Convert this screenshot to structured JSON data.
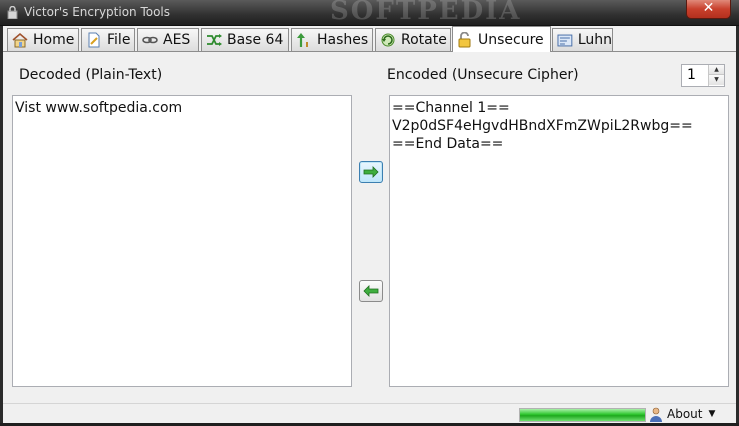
{
  "window": {
    "title": "Victor's Encryption Tools",
    "close_glyph": "✕",
    "watermark": "SOFTPEDIA"
  },
  "tabs": [
    {
      "label": "Home",
      "icon": "home-icon",
      "active": false
    },
    {
      "label": "File",
      "icon": "file-icon",
      "active": false
    },
    {
      "label": "AES",
      "icon": "chain-icon",
      "active": false
    },
    {
      "label": "Base 64",
      "icon": "shuffle-icon",
      "active": false
    },
    {
      "label": "Hashes",
      "icon": "hash-arrow-icon",
      "active": false
    },
    {
      "label": "Rotate",
      "icon": "rotate-icon",
      "active": false
    },
    {
      "label": "Unsecure",
      "icon": "padlock-icon",
      "active": true
    },
    {
      "label": "Luhn",
      "icon": "card-icon",
      "active": false
    }
  ],
  "unsecure": {
    "decoded_label": "Decoded (Plain-Text)",
    "encoded_label": "Encoded (Unsecure Cipher)",
    "decoded_text": "Vist www.softpedia.com",
    "encoded_text": "==Channel 1==\nV2p0dSF4eHgvdHBndXFmZWpiL2Rwbg==\n==End Data==",
    "channel_value": "1"
  },
  "statusbar": {
    "progress": 1.0,
    "about_label": "About"
  },
  "colors": {
    "progress_green": "#2ec62e",
    "arrow_green": "#3fae3f",
    "close_red": "#c8402c"
  }
}
